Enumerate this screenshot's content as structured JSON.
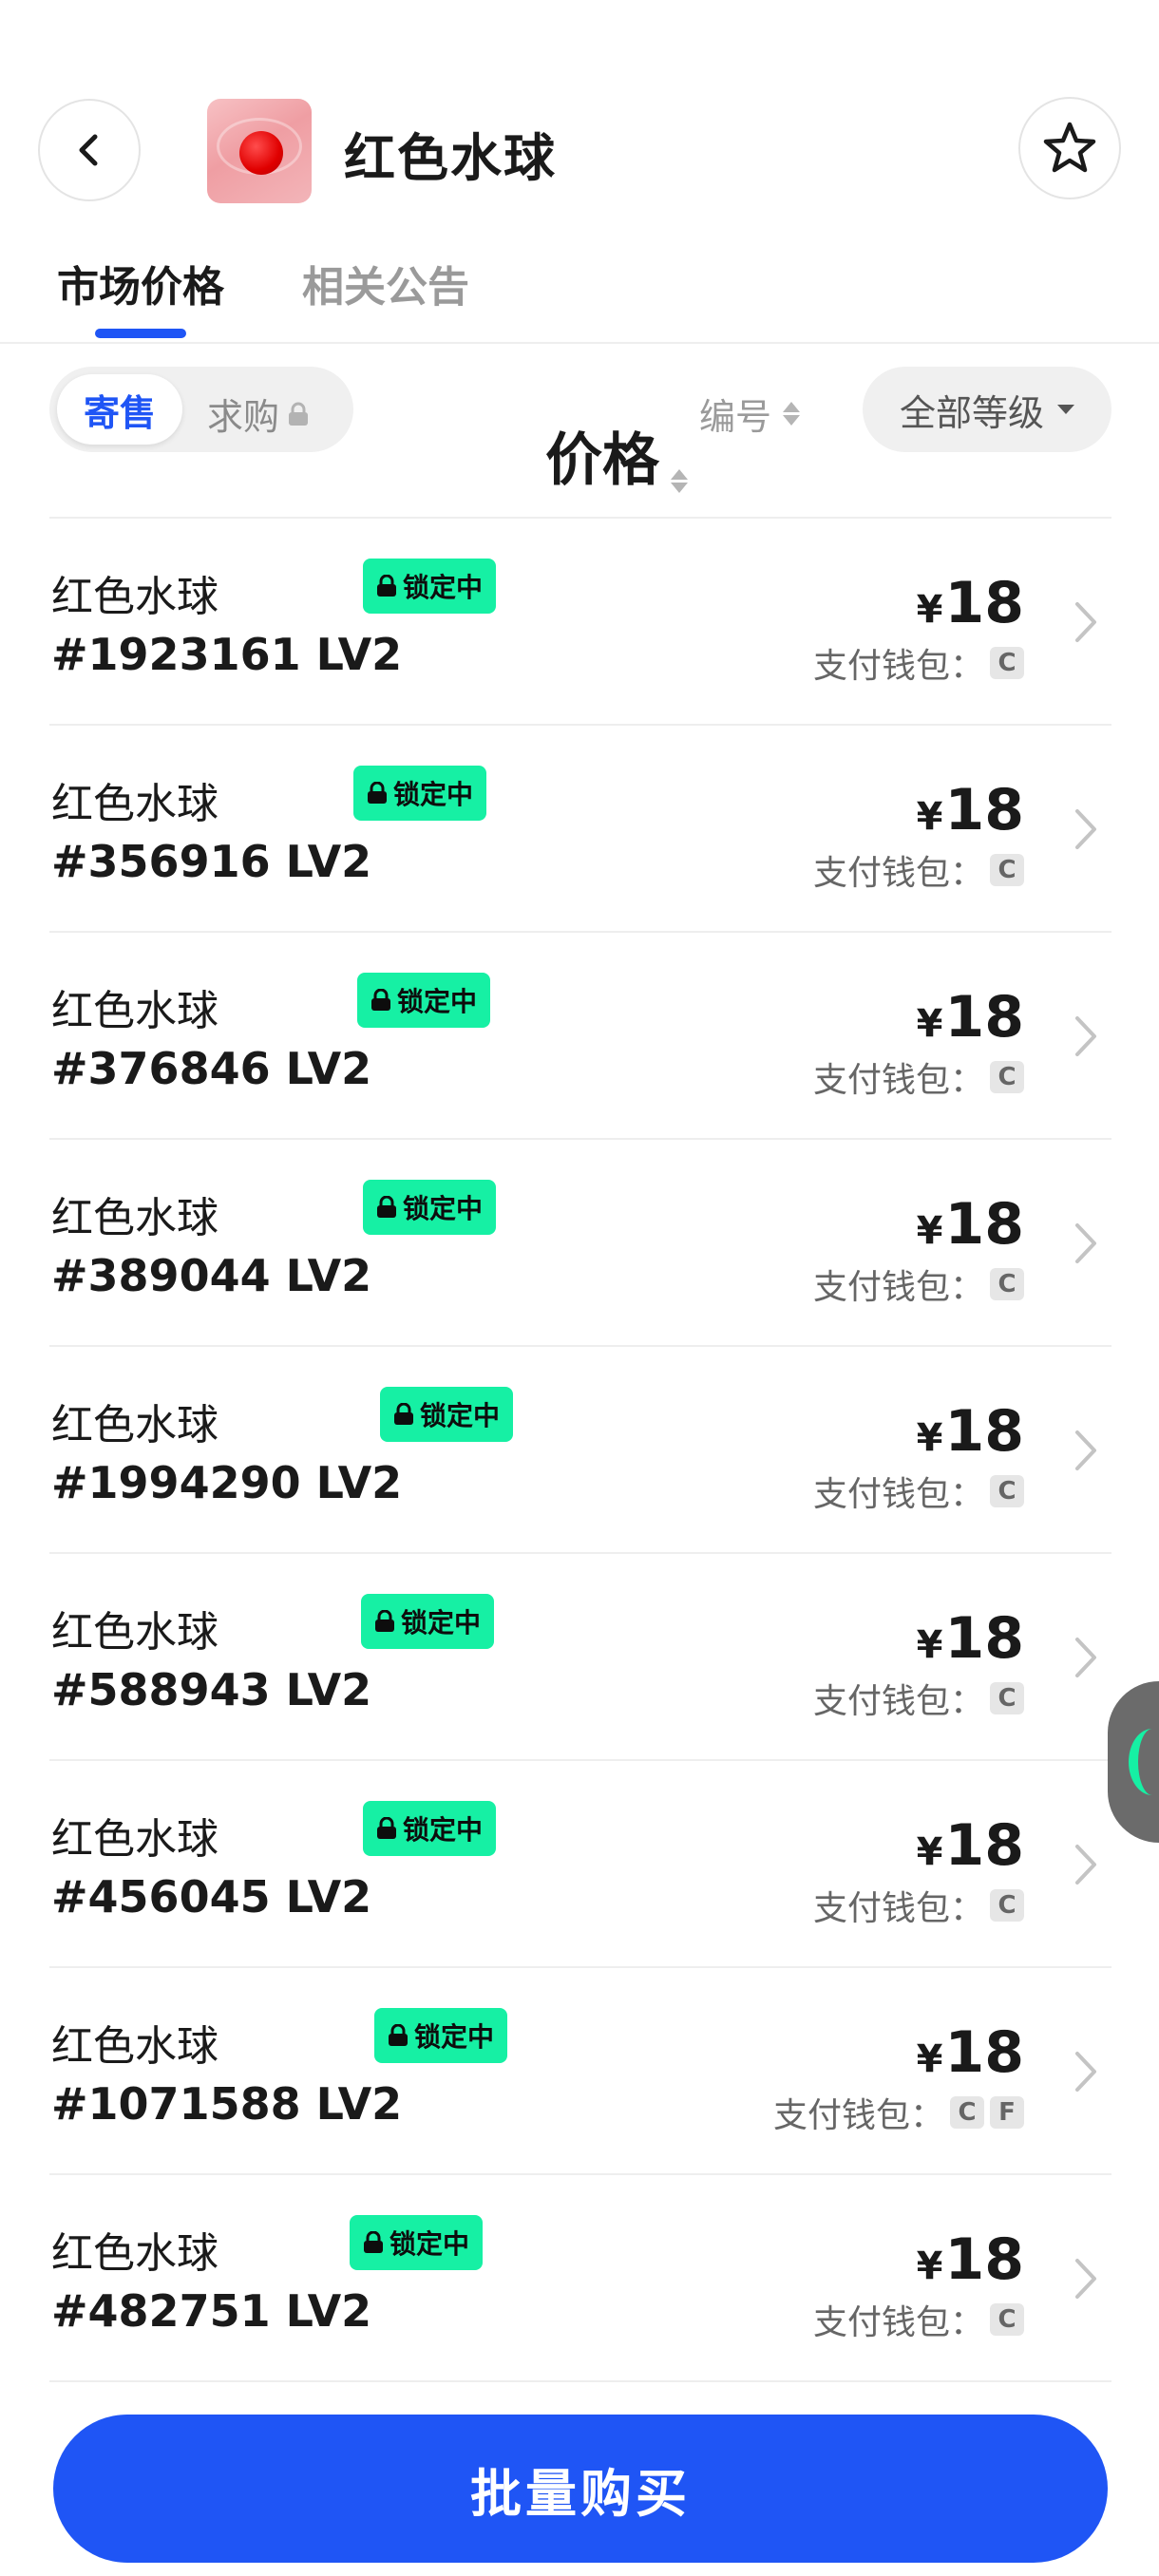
{
  "header": {
    "title": "红色水球"
  },
  "tabs": [
    {
      "label": "市场价格",
      "active": true
    },
    {
      "label": "相关公告",
      "active": false
    }
  ],
  "filters": {
    "segment_active": "寄售",
    "segment_other": "求购",
    "sort_price": "价格",
    "sort_number": "编号",
    "grade": "全部等级"
  },
  "wallet_label": "支付钱包：",
  "items": [
    {
      "name": "红色水球",
      "serial": "#1923161 LV2",
      "status": "锁定中",
      "currency": "¥",
      "price": "18",
      "wallets": [
        "C"
      ]
    },
    {
      "name": "红色水球",
      "serial": "#356916 LV2",
      "status": "锁定中",
      "currency": "¥",
      "price": "18",
      "wallets": [
        "C"
      ]
    },
    {
      "name": "红色水球",
      "serial": "#376846 LV2",
      "status": "锁定中",
      "currency": "¥",
      "price": "18",
      "wallets": [
        "C"
      ]
    },
    {
      "name": "红色水球",
      "serial": "#389044 LV2",
      "status": "锁定中",
      "currency": "¥",
      "price": "18",
      "wallets": [
        "C"
      ]
    },
    {
      "name": "红色水球",
      "serial": "#1994290 LV2",
      "status": "锁定中",
      "currency": "¥",
      "price": "18",
      "wallets": [
        "C"
      ]
    },
    {
      "name": "红色水球",
      "serial": "#588943 LV2",
      "status": "锁定中",
      "currency": "¥",
      "price": "18",
      "wallets": [
        "C"
      ]
    },
    {
      "name": "红色水球",
      "serial": "#456045 LV2",
      "status": "锁定中",
      "currency": "¥",
      "price": "18",
      "wallets": [
        "C"
      ]
    },
    {
      "name": "红色水球",
      "serial": "#1071588 LV2",
      "status": "锁定中",
      "currency": "¥",
      "price": "18",
      "wallets": [
        "C",
        "F"
      ]
    },
    {
      "name": "红色水球",
      "serial": "#482751 LV2",
      "status": "锁定中",
      "currency": "¥",
      "price": "18",
      "wallets": [
        "C"
      ]
    }
  ],
  "buy_button": "批量购买",
  "colors": {
    "accent": "#1f55f5",
    "badge": "#16f0a4",
    "divider": "#eeeeee"
  },
  "icons": [
    "back-arrow-icon",
    "star-icon",
    "lock-icon",
    "chevron-right-icon",
    "sort-arrows-icon",
    "caret-down-icon"
  ]
}
